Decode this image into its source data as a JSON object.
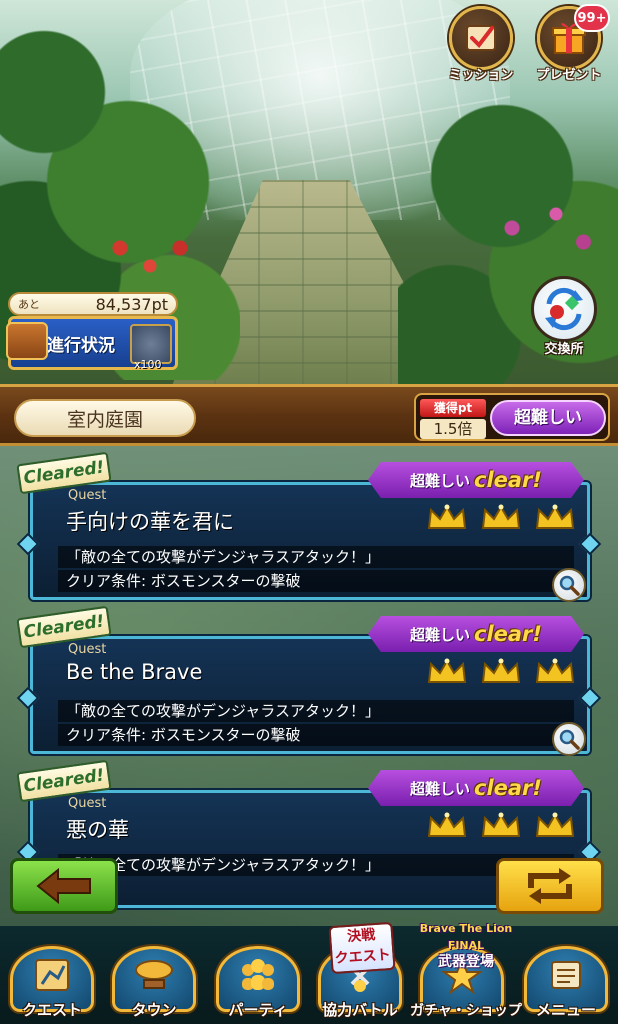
{
  "top_icons": {
    "mission_label": "ミッション",
    "present_label": "プレゼント",
    "present_badge": "99+",
    "exchange_label": "交換所"
  },
  "progress": {
    "ato_label": "あと",
    "points_value": "84,537pt",
    "button_label": "進行状況",
    "reward_count": "x100"
  },
  "area": {
    "name": "室内庭園",
    "pt_label": "獲得pt",
    "pt_multiplier": "1.5倍",
    "difficulty": "超難しい"
  },
  "quests": [
    {
      "cleared_label": "Cleared!",
      "clear_difficulty": "超難しい",
      "clear_text": "clear!",
      "quest_label": "Quest",
      "title": "手向けの華を君に",
      "desc": "「敵の全ての攻撃がデンジャラスアタック！」",
      "condition": "クリア条件: ボスモンスターの撃破",
      "crowns": 3
    },
    {
      "cleared_label": "Cleared!",
      "clear_difficulty": "超難しい",
      "clear_text": "clear!",
      "quest_label": "Quest",
      "title": "Be the Brave",
      "desc": "「敵の全ての攻撃がデンジャラスアタック！」",
      "condition": "クリア条件: ボスモンスターの撃破",
      "crowns": 3
    },
    {
      "cleared_label": "Cleared!",
      "clear_difficulty": "超難しい",
      "clear_text": "clear!",
      "quest_label": "Quest",
      "title": "悪の華",
      "desc": "「敵の全ての攻撃がデンジャラスアタック！」",
      "condition": "",
      "crowns": 3
    }
  ],
  "nav": {
    "items": [
      {
        "label": "クエスト",
        "icon": "quest-map-icon"
      },
      {
        "label": "タウン",
        "icon": "airship-icon"
      },
      {
        "label": "パーティ",
        "icon": "party-icon"
      },
      {
        "label": "協力バトル",
        "icon": "coop-battle-icon"
      },
      {
        "label": "ガチャ・ショップ",
        "icon": "gacha-shop-icon"
      },
      {
        "label": "メニュー",
        "icon": "menu-scroll-icon"
      }
    ],
    "event_tag": {
      "line1": "決戦",
      "line2": "クエスト"
    },
    "gacha_tag": {
      "line1": "Brave The Lion",
      "line2": "FINAL",
      "line3": "武器登場"
    }
  },
  "colors": {
    "quest_border": "#4db7d8",
    "difficulty_purple": "#7e22b8",
    "crown_gold": "#f2c321",
    "back_button_green": "#3f9a18",
    "sort_button_yellow": "#e6a30f"
  }
}
